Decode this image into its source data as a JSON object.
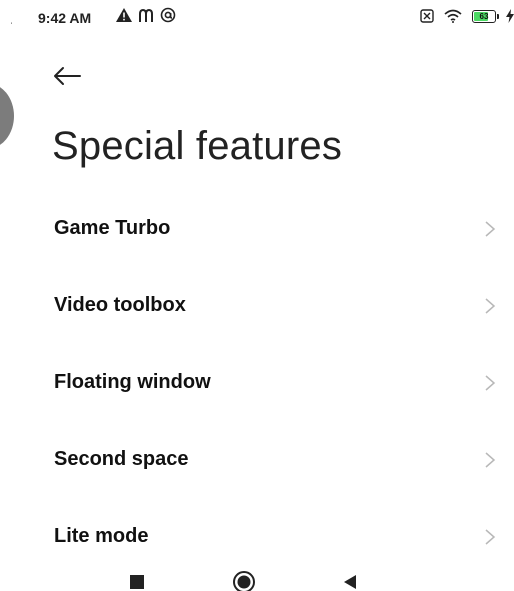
{
  "status_bar": {
    "tick": "ˌ",
    "time": "9:42 AM",
    "left_icons": [
      "warning-icon",
      "m-icon",
      "at-icon"
    ],
    "right_icons": [
      "sim-off-icon",
      "wifi-icon",
      "battery-icon",
      "charging-icon"
    ],
    "battery_level": "63",
    "battery_fraction": 0.63,
    "battery_color": "#4cd964"
  },
  "header": {
    "back_icon": "back-arrow-icon",
    "title": "Special features"
  },
  "menu": {
    "items": [
      {
        "label": "Game Turbo",
        "icon": "chevron-right-icon"
      },
      {
        "label": "Video toolbox",
        "icon": "chevron-right-icon"
      },
      {
        "label": "Floating window",
        "icon": "chevron-right-icon"
      },
      {
        "label": "Second space",
        "icon": "chevron-right-icon"
      },
      {
        "label": "Lite mode",
        "icon": "chevron-right-icon"
      }
    ]
  },
  "nav_bar": {
    "buttons": [
      "recents-square-icon",
      "home-circle-icon",
      "back-triangle-icon"
    ]
  }
}
